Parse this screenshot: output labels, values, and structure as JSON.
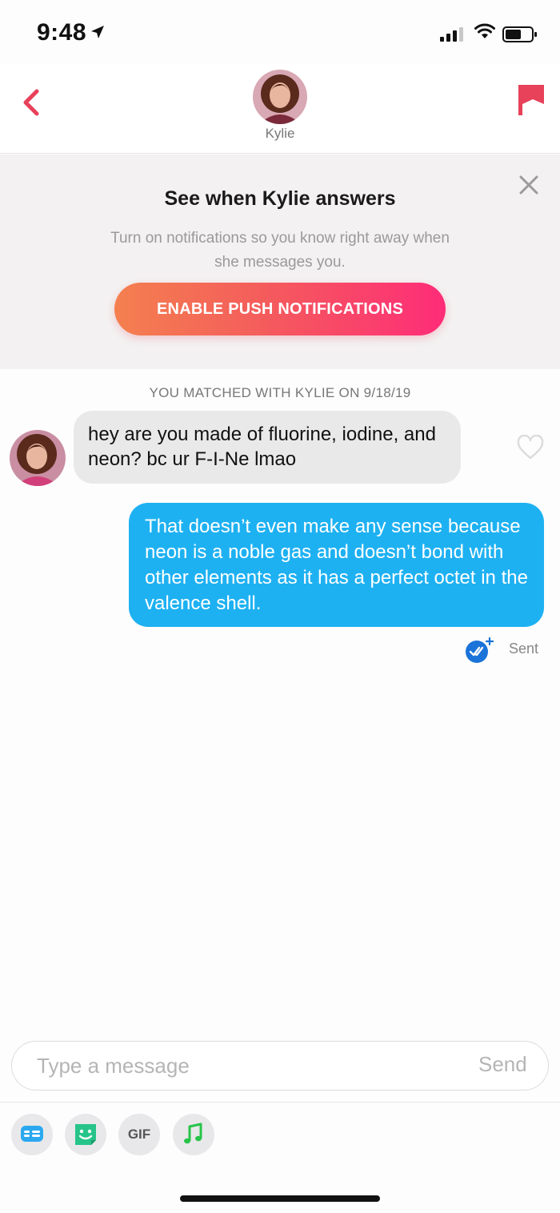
{
  "status_bar": {
    "time": "9:48",
    "icons": [
      "location-arrow-icon",
      "cellular-signal-icon",
      "wifi-icon",
      "battery-icon"
    ]
  },
  "header": {
    "contact_name": "Kylie",
    "back_icon": "chevron-left-icon",
    "report_icon": "flag-icon",
    "accent_color": "#e8415a"
  },
  "banner": {
    "title": "See when Kylie answers",
    "text": "Turn on notifications so you know right away when she messages you.",
    "button_label": "ENABLE PUSH NOTIFICATIONS",
    "close_icon": "close-icon"
  },
  "chat": {
    "match_label": "YOU MATCHED WITH KYLIE ON 9/18/19",
    "messages": [
      {
        "direction": "incoming",
        "text": "hey are you made of fluorine, iodine, and neon? bc ur F-I-Ne lmao"
      },
      {
        "direction": "outgoing",
        "text": "That doesn’t even make any sense because neon is a noble gas and doesn’t bond with other elements as it has a perfect octet in the valence shell."
      }
    ],
    "status": "Sent",
    "outgoing_color": "#1eb1f2",
    "incoming_color": "#e9e9ea"
  },
  "composer": {
    "placeholder": "Type a message",
    "value": "",
    "send_label": "Send"
  },
  "toolbar": {
    "items": [
      "contact-card-icon",
      "sticker-icon",
      "GIF",
      "music-icon"
    ]
  }
}
